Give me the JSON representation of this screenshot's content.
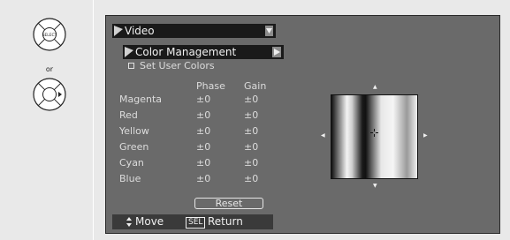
{
  "remote": {
    "select_label": "SELECT",
    "or_label": "or"
  },
  "menu": {
    "title": "Video",
    "submenu": "Color Management",
    "option_label": "Set User Colors"
  },
  "table": {
    "headers": [
      "Phase",
      "Gain"
    ],
    "rows": [
      {
        "name": "Magenta",
        "phase": "±0",
        "gain": "±0"
      },
      {
        "name": "Red",
        "phase": "±0",
        "gain": "±0"
      },
      {
        "name": "Yellow",
        "phase": "±0",
        "gain": "±0"
      },
      {
        "name": "Green",
        "phase": "±0",
        "gain": "±0"
      },
      {
        "name": "Cyan",
        "phase": "±0",
        "gain": "±0"
      },
      {
        "name": "Blue",
        "phase": "±0",
        "gain": "±0"
      }
    ]
  },
  "reset_label": "Reset",
  "footer": {
    "move_label": "Move",
    "sel_badge": "SEL",
    "return_label": "Return"
  },
  "icons": {
    "move_arrows": "up-down-arrow",
    "crosshair": "crosshair-icon"
  },
  "colors": {
    "screen_bg": "#6a6a6a",
    "bar_bg": "#1a1a1a",
    "text": "#dcdcdc"
  }
}
